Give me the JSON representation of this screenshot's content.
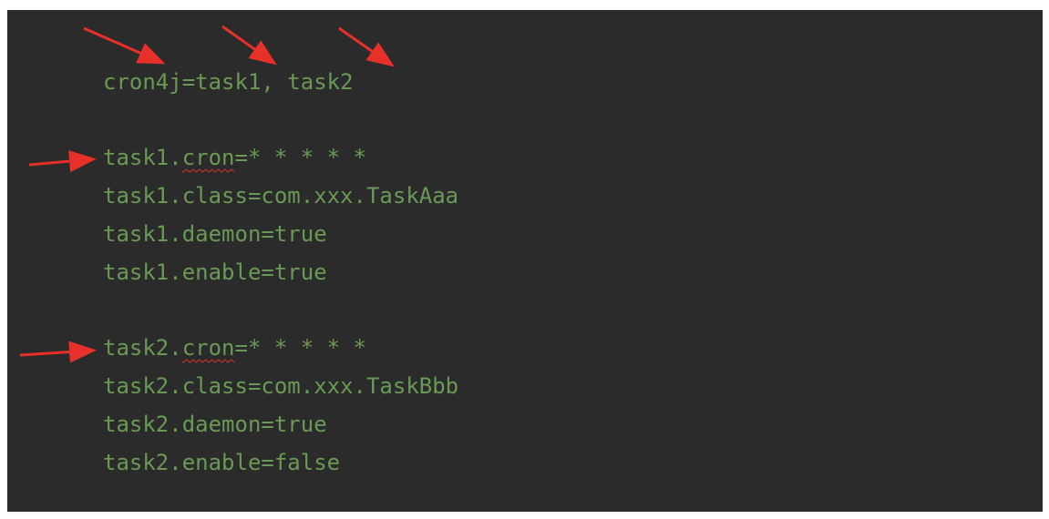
{
  "editor": {
    "lines": {
      "cron4j": "cron4j=task1, task2",
      "task1_cron_prefix": "task1.",
      "task1_cron_key": "cron",
      "task1_cron_value": "=* * * * *",
      "task1_class": "task1.class=com.xxx.TaskAaa",
      "task1_daemon": "task1.daemon=true",
      "task1_enable": "task1.enable=true",
      "task2_cron_prefix": "task2.",
      "task2_cron_key": "cron",
      "task2_cron_value": "=* * * * *",
      "task2_class": "task2.class=com.xxx.TaskBbb",
      "task2_daemon": "task2.daemon=true",
      "task2_enable": "task2.enable=false"
    }
  },
  "colors": {
    "background": "#2b2b2b",
    "text": "#6a9955",
    "annotation_arrow": "#e8302a",
    "spellcheck_underline": "#d8362a"
  }
}
